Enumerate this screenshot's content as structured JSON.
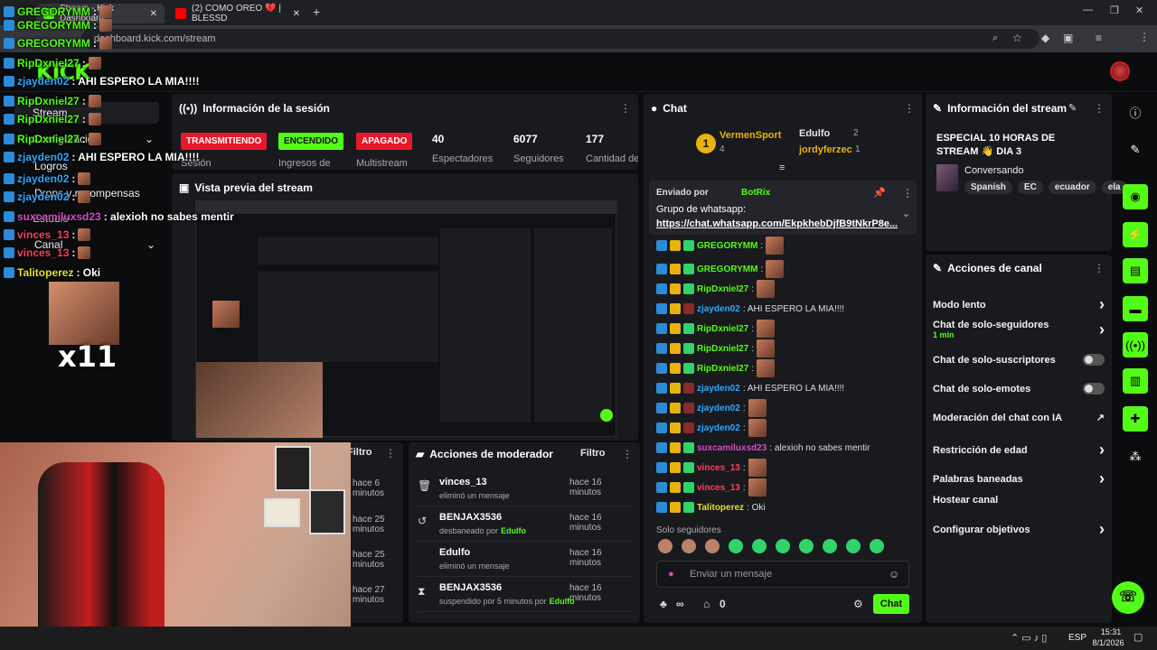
{
  "browser": {
    "tabs": [
      {
        "title": "Stream - Kick Dashboard",
        "active": true
      },
      {
        "title": "(2) COMO OREO 💔 | BLESSD",
        "active": false
      }
    ],
    "url": "dashboard.kick.com/stream",
    "new_tab": "+",
    "window_controls": [
      "—",
      "❐",
      "✕"
    ]
  },
  "kick": {
    "logo": "KICK"
  },
  "sidebar": {
    "items": [
      {
        "label": "Stream",
        "selected": true,
        "chevron": ""
      },
      {
        "label": "Configuración",
        "selected": false,
        "chevron": "⌄"
      },
      {
        "label": "Estudio",
        "selected": false,
        "chevron": ""
      },
      {
        "label": "Logros",
        "selected": false,
        "chevron": ""
      },
      {
        "label": "Drops y recompensas",
        "selected": false,
        "chevron": ""
      },
      {
        "label": "Canal",
        "selected": false,
        "chevron": "⌄"
      }
    ]
  },
  "session": {
    "title": "Información de la sesión",
    "badges": [
      {
        "label": "TRANSMITIENDO",
        "color": "#e7182b",
        "caption": "Sesión"
      },
      {
        "label": "ENCENDIDO",
        "color": "#53fc18",
        "caption": "Ingresos de"
      },
      {
        "label": "APAGADO",
        "color": "#e7182b",
        "caption": "Multistream"
      }
    ],
    "stats": [
      {
        "value": "40",
        "label": "Espectadores"
      },
      {
        "value": "6077",
        "label": "Seguidores"
      },
      {
        "value": "177",
        "label": "Cantidad de suscripciones"
      }
    ]
  },
  "preview": {
    "title": "Vista previa del stream"
  },
  "stream_overlay": {
    "multiplier": "x11",
    "chat": [
      {
        "user": "GREGORYMM",
        "color": "green",
        "msg": ":"
      },
      {
        "user": "GREGORYMM",
        "color": "green",
        "msg": ":"
      },
      {
        "user": "GREGORYMM",
        "color": "green",
        "msg": ":"
      },
      {
        "user": "RipDxniel27",
        "color": "green",
        "msg": ":"
      },
      {
        "user": "zjayden02",
        "color": "blue",
        "msg": ": AHI ESPERO LA MIA!!!!"
      },
      {
        "user": "RipDxniel27",
        "color": "green",
        "msg": ":"
      },
      {
        "user": "RipDxniel27",
        "color": "green",
        "msg": ":"
      },
      {
        "user": "RipDxniel27",
        "color": "green",
        "msg": ":"
      },
      {
        "user": "zjayden02",
        "color": "blue",
        "msg": ": AHI ESPERO LA MIA!!!!"
      },
      {
        "user": "zjayden02",
        "color": "blue",
        "msg": ":"
      },
      {
        "user": "zjayden02",
        "color": "blue",
        "msg": ":"
      },
      {
        "user": "suxcamiluxsd23",
        "color": "mag",
        "msg": ": alexioh no sabes mentir"
      },
      {
        "user": "vinces_13",
        "color": "red",
        "msg": ":"
      },
      {
        "user": "vinces_13",
        "color": "red",
        "msg": ":"
      },
      {
        "user": "Talitoperez",
        "color": "yel",
        "msg": ": Oki"
      }
    ]
  },
  "moderation_log": {
    "filter": "Filtro",
    "times": [
      "hace 6 minutos",
      "hace 25 minutos",
      "hace 25 minutos",
      "hace 27 minutos"
    ]
  },
  "mod_actions": {
    "title": "Acciones de moderador",
    "filter": "Filtro",
    "rows": [
      {
        "icon": "🗑",
        "user": "vinces_13",
        "time": "hace 16 minutos",
        "action": "eliminó un mensaje",
        "by": ""
      },
      {
        "icon": "↺",
        "user": "BENJAX3536",
        "time": "hace 16 minutos",
        "action": "desbaneado por",
        "by": "Edulfo"
      },
      {
        "icon": "",
        "user": "Edulfo",
        "time": "hace 16 minutos",
        "action": "eliminó un mensaje",
        "by": ""
      },
      {
        "icon": "⧗",
        "user": "BENJAX3536",
        "time": "hace 16 minutos",
        "action": "suspendido por 5 minutos por",
        "by": "Edulfo"
      }
    ]
  },
  "chat": {
    "title": "Chat",
    "leaders": [
      {
        "name": "VermenSport",
        "count": "4"
      },
      {
        "name": "Edulfo",
        "count": "2"
      },
      {
        "name": "jordyferzec",
        "count": "1"
      }
    ],
    "rank": "1",
    "pinned": {
      "sent_by": "Enviado por",
      "bot": "BotRix",
      "title": "Grupo de whatsapp:",
      "link": "https://chat.whatsapp.com/EkpkhebDjfB9tNkrP8e..."
    },
    "messages": [
      {
        "user": "GREGORYMM",
        "color": "green",
        "text": ":",
        "emote": true
      },
      {
        "user": "GREGORYMM",
        "color": "green",
        "text": ":",
        "emote": true
      },
      {
        "user": "RipDxniel27",
        "color": "green",
        "text": ":",
        "emote": true
      },
      {
        "user": "zjayden02",
        "color": "blue",
        "text": ": AHI ESPERO LA MIA!!!!",
        "emote": false
      },
      {
        "user": "RipDxniel27",
        "color": "green",
        "text": ":",
        "emote": true
      },
      {
        "user": "RipDxniel27",
        "color": "green",
        "text": ":",
        "emote": true
      },
      {
        "user": "RipDxniel27",
        "color": "green",
        "text": ":",
        "emote": true
      },
      {
        "user": "zjayden02",
        "color": "blue",
        "text": ": AHI ESPERO LA MIA!!!!",
        "emote": false
      },
      {
        "user": "zjayden02",
        "color": "blue",
        "text": ":",
        "emote": true
      },
      {
        "user": "zjayden02",
        "color": "blue",
        "text": ":",
        "emote": true
      },
      {
        "user": "suxcamiluxsd23",
        "color": "mag",
        "text": ": alexioh no sabes mentir",
        "emote": false
      },
      {
        "user": "vinces_13",
        "color": "red",
        "text": ":",
        "emote": true
      },
      {
        "user": "vinces_13",
        "color": "red",
        "text": ":",
        "emote": true
      },
      {
        "user": "Talitoperez",
        "color": "yel",
        "text": ": Oki",
        "emote": false
      }
    ],
    "mode": "Solo seguidores",
    "input_placeholder": "Enviar un mensaje",
    "points": "∞",
    "gifts": "0",
    "send_label": "Chat"
  },
  "stream_info": {
    "title": "Información del stream",
    "stream_title": "ESPECIAL 10 HORAS DE STREAM 👋 DIA 3",
    "category": "Conversando",
    "tags": [
      "Spanish",
      "EC",
      "ecuador",
      "ela"
    ]
  },
  "channel_actions": {
    "title": "Acciones de canal",
    "items": [
      {
        "label": "Modo lento",
        "control": "chevron",
        "sub": ""
      },
      {
        "label": "Chat de solo-seguidores",
        "control": "chevron",
        "sub": "1 min"
      },
      {
        "label": "Chat de solo-suscriptores",
        "control": "toggle",
        "sub": ""
      },
      {
        "label": "Chat de solo-emotes",
        "control": "toggle",
        "sub": ""
      },
      {
        "label": "Moderación del chat con IA",
        "control": "external",
        "sub": ""
      },
      {
        "label": "Restricción de edad",
        "control": "chevron",
        "sub": ""
      },
      {
        "label": "Palabras baneadas",
        "control": "chevron",
        "sub": ""
      },
      {
        "label": "Hostear canal",
        "control": "",
        "sub": ""
      },
      {
        "label": "Configurar objetivos",
        "control": "chevron",
        "sub": ""
      }
    ]
  },
  "taskbar": {
    "lang": "ESP",
    "time": "15:31",
    "date": "8/1/2026"
  },
  "colors": {
    "accent": "#53fc18",
    "live": "#e7182b",
    "panel": "#191a1e"
  }
}
